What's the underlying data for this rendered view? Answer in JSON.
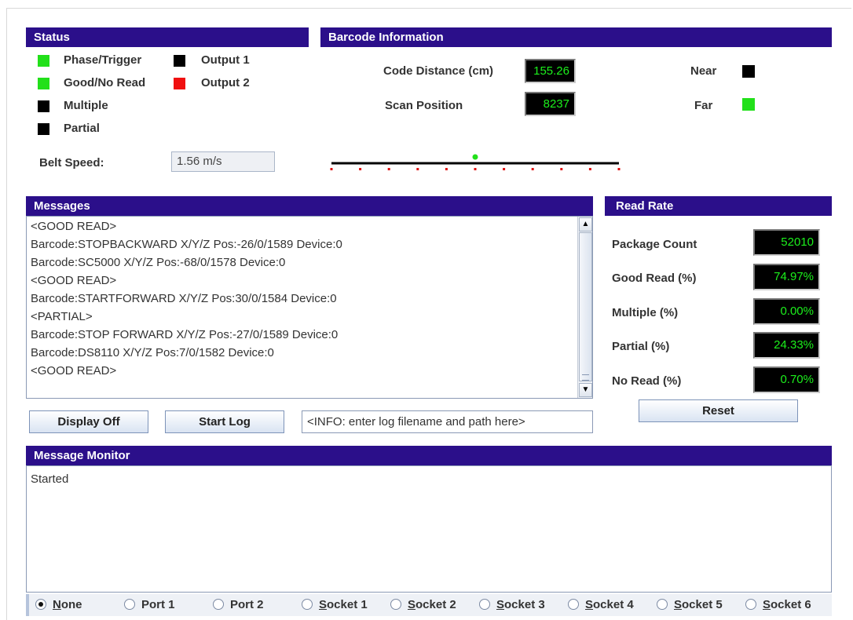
{
  "status": {
    "title": "Status",
    "indicators": [
      {
        "label": "Phase/Trigger",
        "state": "green"
      },
      {
        "label": "Good/No Read",
        "state": "green"
      },
      {
        "label": "Multiple",
        "state": "black"
      },
      {
        "label": "Partial",
        "state": "black"
      },
      {
        "label": "Output 1",
        "state": "black"
      },
      {
        "label": "Output 2",
        "state": "red"
      }
    ],
    "belt_speed_label": "Belt Speed:",
    "belt_speed_value": "1.56 m/s"
  },
  "barcode": {
    "title": "Barcode Information",
    "code_distance_label": "Code Distance (cm)",
    "code_distance_value": "155.26",
    "scan_position_label": "Scan Position",
    "scan_position_value": "8237",
    "near_label": "Near",
    "near_state": "black",
    "far_label": "Far",
    "far_state": "green",
    "scan_marker_fraction": 0.5
  },
  "messages": {
    "title": "Messages",
    "lines": [
      "<GOOD READ>",
      "Barcode:STOPBACKWARD  X/Y/Z Pos:-26/0/1589 Device:0",
      "Barcode:SC5000  X/Y/Z Pos:-68/0/1578 Device:0",
      "<GOOD READ>",
      "Barcode:STARTFORWARD  X/Y/Z Pos:30/0/1584 Device:0",
      "<PARTIAL>",
      "Barcode:STOP FORWARD  X/Y/Z Pos:-27/0/1589 Device:0",
      "Barcode:DS8110  X/Y/Z Pos:7/0/1582 Device:0",
      "<GOOD READ>"
    ],
    "display_off_label": "Display Off",
    "start_log_label": "Start Log",
    "log_path_value": "<INFO: enter log filename and path here>"
  },
  "read_rate": {
    "title": "Read Rate",
    "rows": [
      {
        "label": "Package Count",
        "value": "52010"
      },
      {
        "label": "Good Read (%)",
        "value": "74.97%"
      },
      {
        "label": "Multiple (%)",
        "value": "0.00%"
      },
      {
        "label": "Partial (%)",
        "value": "24.33%"
      },
      {
        "label": "No Read (%)",
        "value": "0.70%"
      }
    ],
    "reset_label": "Reset"
  },
  "monitor": {
    "title": "Message Monitor",
    "text": "Started",
    "source_options": [
      {
        "label": "None",
        "mnemonic": "N",
        "selected": true
      },
      {
        "label": "Port 1",
        "mnemonic": "",
        "selected": false
      },
      {
        "label": "Port 2",
        "mnemonic": "",
        "selected": false
      },
      {
        "label": "Socket 1",
        "mnemonic": "S",
        "selected": false
      },
      {
        "label": "Socket 2",
        "mnemonic": "S",
        "selected": false
      },
      {
        "label": "Socket 3",
        "mnemonic": "S",
        "selected": false
      },
      {
        "label": "Socket 4",
        "mnemonic": "S",
        "selected": false
      },
      {
        "label": "Socket 5",
        "mnemonic": "S",
        "selected": false
      },
      {
        "label": "Socket 6",
        "mnemonic": "S",
        "selected": false
      }
    ]
  },
  "colors": {
    "header_bg": "#2b0f8a",
    "led_green": "#22e01a",
    "led_red": "#f01010",
    "lcd_text": "#1cf01c"
  }
}
